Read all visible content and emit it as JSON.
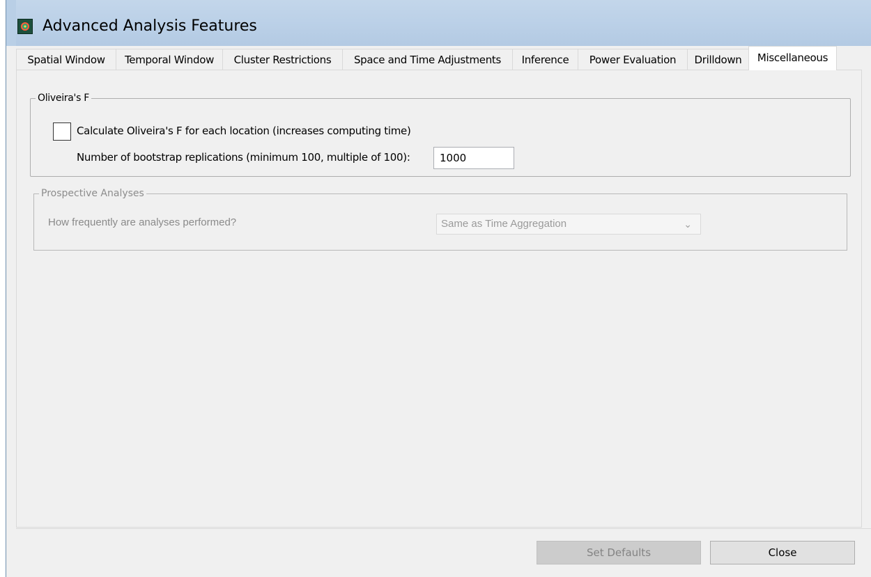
{
  "window": {
    "title": "Advanced Analysis Features"
  },
  "tabs": [
    {
      "label": "Spatial Window",
      "active": false
    },
    {
      "label": "Temporal Window",
      "active": false
    },
    {
      "label": "Cluster Restrictions",
      "active": false
    },
    {
      "label": "Space and Time Adjustments",
      "active": false
    },
    {
      "label": "Inference",
      "active": false
    },
    {
      "label": "Power Evaluation",
      "active": false
    },
    {
      "label": "Drilldown",
      "active": false
    },
    {
      "label": "Miscellaneous",
      "active": true
    }
  ],
  "oliveira": {
    "group_title": "Oliveira's F",
    "checkbox_label": "Calculate Oliveira's F for each location (increases computing time)",
    "checkbox_checked": false,
    "replications_label": "Number of bootstrap replications (minimum 100, multiple of 100):",
    "replications_value": "1000"
  },
  "prospective": {
    "group_title": "Prospective Analyses",
    "frequency_label": "How frequently are analyses performed?",
    "frequency_selected": "Same as Time Aggregation",
    "enabled": false
  },
  "buttons": {
    "set_defaults": "Set Defaults",
    "close": "Close"
  }
}
